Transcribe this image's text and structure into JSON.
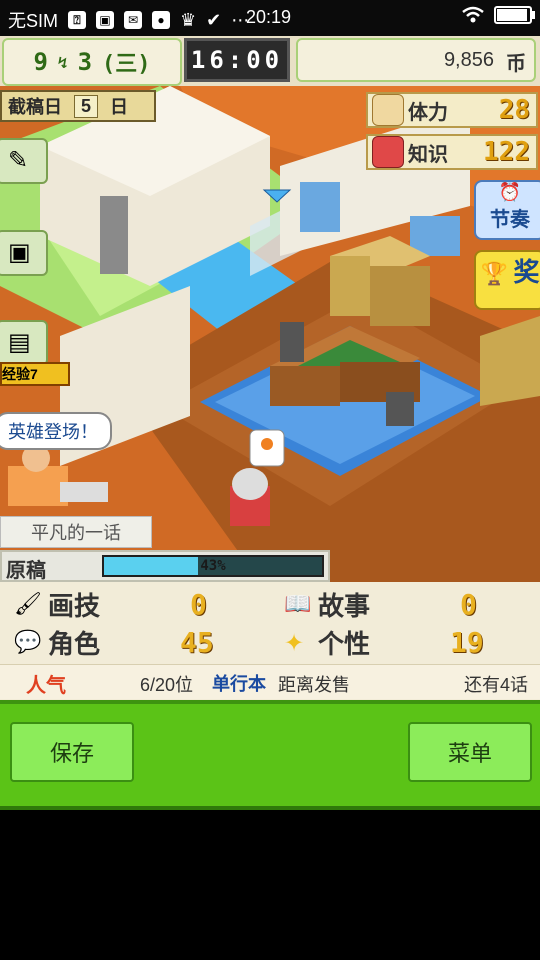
{
  "status_bar": {
    "carrier": "无SIM",
    "time": "20:19",
    "icons": [
      "sim-status-icon",
      "image-notification-icon",
      "mail-icon",
      "app-icon",
      "crown-icon",
      "check-icon",
      "more-dots-icon",
      "wifi-icon",
      "battery-icon"
    ]
  },
  "top_bar": {
    "month": "9",
    "day": "3",
    "weekday": "(三)",
    "clock": "16:00",
    "money": "9,856",
    "money_unit": "币"
  },
  "scene": {
    "deadline_label": "截稿日",
    "deadline_days": "5",
    "deadline_unit": "日",
    "stamina_label": "体力",
    "stamina_value": "28",
    "knowledge_label": "知识",
    "knowledge_value": "122",
    "side_tag": "经验7",
    "speech_bubble": "英雄登场！",
    "rhythm_button": "节奏",
    "award_button": "奖",
    "episode_title": "平凡的一话",
    "manuscript_label": "原稿",
    "manuscript_progress_text": "43%",
    "manuscript_progress": 0.43
  },
  "info": {
    "drawing_label": "画技",
    "drawing_value": "0",
    "story_label": "故事",
    "story_value": "0",
    "character_label": "角色",
    "character_value": "45",
    "personality_label": "个性",
    "personality_value": "19",
    "popularity_label": "人气",
    "rank": "6/20位",
    "volume_label": "单行本",
    "release_label": "距离发售",
    "remaining": "还有4话"
  },
  "bottom_bar": {
    "save_label": "保存",
    "menu_label": "菜单"
  },
  "colors": {
    "green_bar": "#5bc317",
    "green_button": "#8cec5a",
    "gold_value": "#e8b020",
    "progress_fill": "#5ad0ef"
  }
}
